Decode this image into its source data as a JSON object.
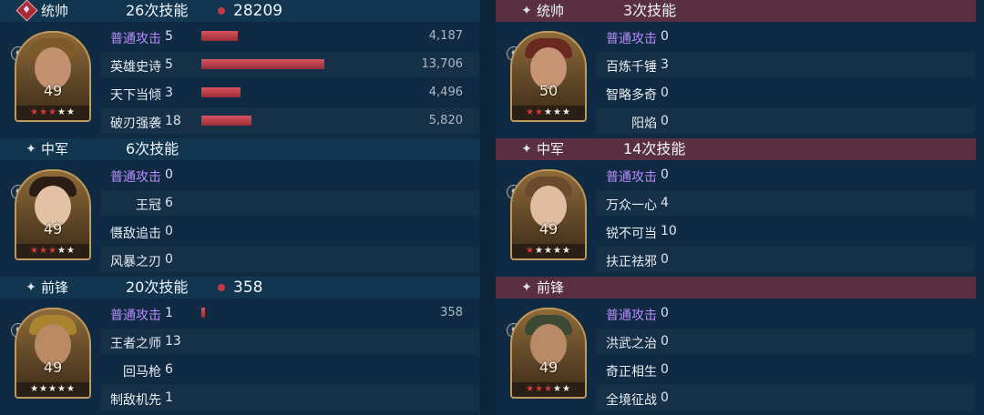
{
  "left_team": {
    "units": [
      {
        "role": "统帅",
        "skill_count": "26次技能",
        "total_damage": "28209",
        "level": "49",
        "star_colors": [
          "#d23b3b",
          "#d23b3b",
          "#d23b3b",
          "#f2f2f2",
          "#f2f2f2"
        ],
        "skills": [
          {
            "name": "普通攻击",
            "count": "5",
            "bar": 0.14,
            "damage": "4,187",
            "type": "normal"
          },
          {
            "name": "英雄史诗",
            "count": "5",
            "bar": 0.47,
            "damage": "13,706",
            "type": "skill"
          },
          {
            "name": "天下当倾",
            "count": "3",
            "bar": 0.15,
            "damage": "4,496",
            "type": "skill"
          },
          {
            "name": "破刃强袭",
            "count": "18",
            "bar": 0.19,
            "damage": "5,820",
            "type": "skill"
          }
        ]
      },
      {
        "role": "中军",
        "skill_count": "6次技能",
        "total_damage": "",
        "level": "49",
        "star_colors": [
          "#d23b3b",
          "#d23b3b",
          "#d23b3b",
          "#f2f2f2",
          "#f2f2f2"
        ],
        "skills": [
          {
            "name": "普通攻击",
            "count": "0",
            "bar": 0,
            "damage": "",
            "type": "normal"
          },
          {
            "name": "王冠",
            "count": "6",
            "bar": 0,
            "damage": "",
            "type": "skill"
          },
          {
            "name": "慑敌追击",
            "count": "0",
            "bar": 0,
            "damage": "",
            "type": "skill"
          },
          {
            "name": "风暴之刃",
            "count": "0",
            "bar": 0,
            "damage": "",
            "type": "skill"
          }
        ]
      },
      {
        "role": "前锋",
        "skill_count": "20次技能",
        "total_damage": "358",
        "level": "49",
        "star_colors": [
          "#f2f2f2",
          "#f2f2f2",
          "#f2f2f2",
          "#f2f2f2",
          "#f2f2f2"
        ],
        "skills": [
          {
            "name": "普通攻击",
            "count": "1",
            "bar": 0.012,
            "damage": "358",
            "type": "normal"
          },
          {
            "name": "王者之师",
            "count": "13",
            "bar": 0,
            "damage": "",
            "type": "skill"
          },
          {
            "name": "回马枪",
            "count": "6",
            "bar": 0,
            "damage": "",
            "type": "skill"
          },
          {
            "name": "制敌机先",
            "count": "1",
            "bar": 0,
            "damage": "",
            "type": "skill"
          }
        ]
      }
    ]
  },
  "right_team": {
    "units": [
      {
        "role": "统帅",
        "skill_count": "3次技能",
        "total_damage": "",
        "level": "50",
        "star_colors": [
          "#d23b3b",
          "#d23b3b",
          "#f2f2f2",
          "#f2f2f2",
          "#f2f2f2"
        ],
        "skills": [
          {
            "name": "普通攻击",
            "count": "0",
            "type": "normal"
          },
          {
            "name": "百炼千锤",
            "count": "3",
            "type": "skill"
          },
          {
            "name": "智略多奇",
            "count": "0",
            "type": "skill"
          },
          {
            "name": "阳焰",
            "count": "0",
            "type": "skill"
          }
        ]
      },
      {
        "role": "中军",
        "skill_count": "14次技能",
        "total_damage": "",
        "level": "49",
        "star_colors": [
          "#d23b3b",
          "#f2f2f2",
          "#f2f2f2",
          "#f2f2f2",
          "#f2f2f2"
        ],
        "skills": [
          {
            "name": "普通攻击",
            "count": "0",
            "type": "normal"
          },
          {
            "name": "万众一心",
            "count": "4",
            "type": "skill"
          },
          {
            "name": "锐不可当",
            "count": "10",
            "type": "skill"
          },
          {
            "name": "扶正祛邪",
            "count": "0",
            "type": "skill"
          }
        ]
      },
      {
        "role": "前锋",
        "skill_count": "",
        "total_damage": "",
        "level": "49",
        "star_colors": [
          "#d23b3b",
          "#d23b3b",
          "#d23b3b",
          "#f2f2f2",
          "#f2f2f2"
        ],
        "skills": [
          {
            "name": "普通攻击",
            "count": "0",
            "type": "normal"
          },
          {
            "name": "洪武之治",
            "count": "0",
            "type": "skill"
          },
          {
            "name": "奇正相生",
            "count": "0",
            "type": "skill"
          },
          {
            "name": "全境征战",
            "count": "0",
            "type": "skill"
          }
        ]
      }
    ]
  },
  "icons": {
    "role_commander_badge": "commander-badge-icon",
    "role_sparkle": "sparkle-icon",
    "damage_dot": "damage-dot-icon",
    "unit_type": "horse-icon",
    "star_glyph": "★"
  },
  "colors": {
    "normal_attack_label": "#b48ff7",
    "damage_bar": "#c23a45",
    "ally_header": "#123550",
    "enemy_header": "#5a3040"
  }
}
